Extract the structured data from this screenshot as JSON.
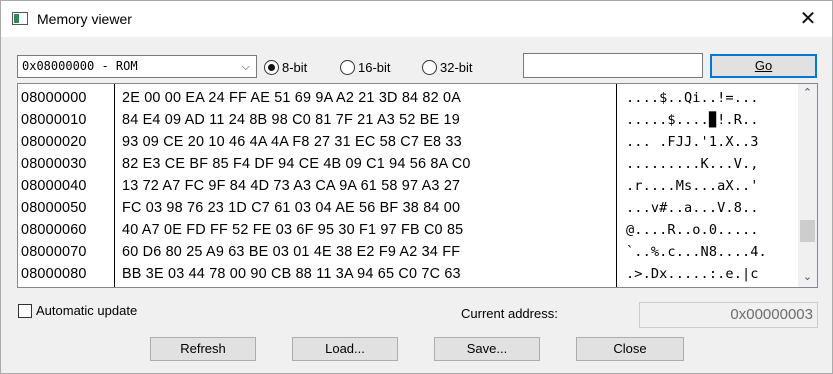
{
  "window": {
    "title": "Memory viewer",
    "close_glyph": "✕"
  },
  "toolbar": {
    "region_selected": "0x08000000 - ROM",
    "radios": [
      {
        "label": "8-bit",
        "checked": true
      },
      {
        "label": "16-bit",
        "checked": false
      },
      {
        "label": "32-bit",
        "checked": false
      }
    ],
    "address_value": "",
    "go_label": "Go"
  },
  "hex_view": {
    "addresses": [
      "08000000",
      "08000010",
      "08000020",
      "08000030",
      "08000040",
      "08000050",
      "08000060",
      "08000070",
      "08000080"
    ],
    "hex_rows": [
      "2E 00 00 EA 24 FF AE 51 69 9A A2 21 3D 84 82 0A",
      "84 E4 09 AD 11 24 8B 98 C0 81 7F 21 A3 52 BE 19",
      "93 09 CE 20 10 46 4A 4A F8 27 31 EC 58 C7 E8 33",
      "82 E3 CE BF 85 F4 DF 94 CE 4B 09 C1 94 56 8A C0",
      "13 72 A7 FC 9F 84 4D 73 A3 CA 9A 61 58 97 A3 27",
      "FC 03 98 76 23 1D C7 61 03 04 AE 56 BF 38 84 00",
      "40 A7 0E FD FF 52 FE 03 6F 95 30 F1 97 FB C0 85",
      "60 D6 80 25 A9 63 BE 03 01 4E 38 E2 F9 A2 34 FF",
      "BB 3E 03 44 78 00 90 CB 88 11 3A 94 65 C0 7C 63"
    ],
    "ascii_rows": [
      "....$..Qi..!=...",
      ".....$....▉!.R..",
      "... .FJJ.'1.X..3",
      ".........K...V.,",
      ".r....Ms...aX..'",
      "...v#..a...V.8..",
      "@....R..o.0.....",
      "`..%.c...N8....4.",
      ".>.Dx.....:.e.|c"
    ]
  },
  "footer": {
    "auto_update_label": "Automatic update",
    "current_address_label": "Current address:",
    "current_address_value": "0x00000003",
    "buttons": {
      "refresh": "Refresh",
      "load": "Load...",
      "save": "Save...",
      "close": "Close"
    }
  }
}
